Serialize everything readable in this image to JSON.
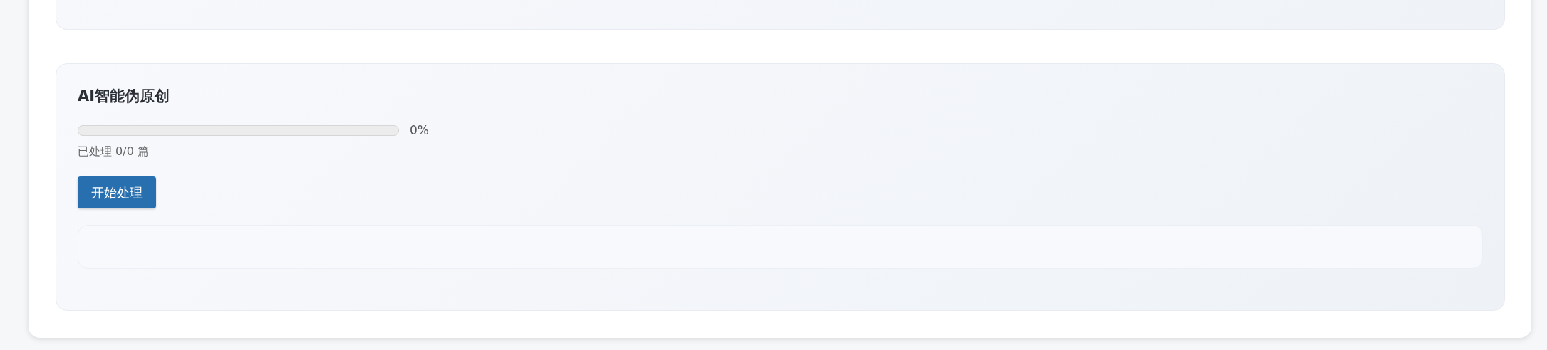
{
  "card": {
    "title": "AI智能伪原创",
    "progress": {
      "level": 0,
      "reading": "0%"
    },
    "status": "已处理 0/0 篇",
    "button": {
      "label": "开始处理"
    }
  }
}
